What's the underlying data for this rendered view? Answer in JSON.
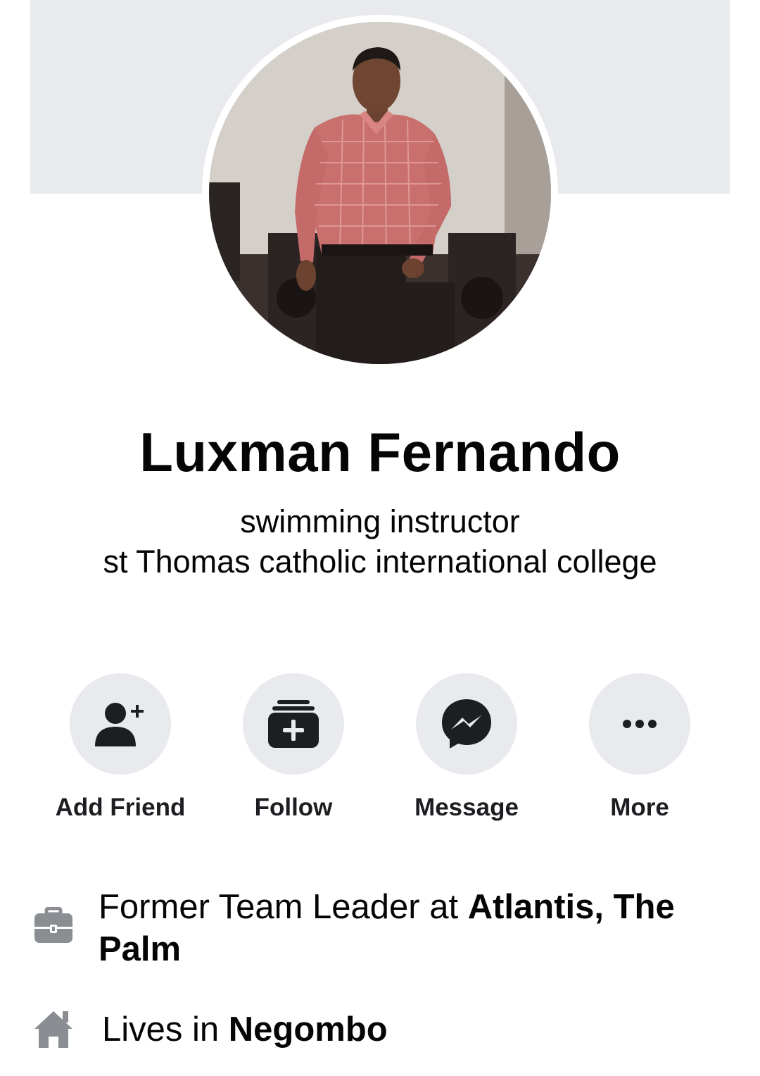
{
  "profile": {
    "name": "Luxman Fernando",
    "bio_line_1": "swimming instructor",
    "bio_line_2": "st Thomas catholic international college"
  },
  "actions": [
    {
      "label": "Add Friend",
      "icon": "add-friend-icon"
    },
    {
      "label": "Follow",
      "icon": "follow-icon"
    },
    {
      "label": "Message",
      "icon": "messenger-icon"
    },
    {
      "label": "More",
      "icon": "more-dots-icon"
    }
  ],
  "details": {
    "work": {
      "icon": "briefcase-icon",
      "prefix": "Former Team Leader at ",
      "place": "Atlantis, The Palm"
    },
    "home": {
      "icon": "house-icon",
      "prefix": "Lives in ",
      "place": "Negombo"
    }
  },
  "colors": {
    "cover": "#e9eaed",
    "button_bg": "#e9eaed",
    "icon_dark": "#1c1e21",
    "icon_grey": "#8a8d91",
    "text": "#050505"
  }
}
